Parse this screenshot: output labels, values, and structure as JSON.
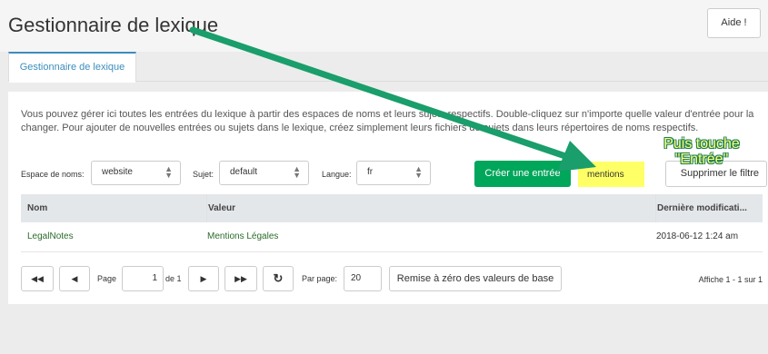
{
  "header": {
    "title": "Gestionnaire de lexique",
    "help_label": "Aide !"
  },
  "tabs": [
    {
      "label": "Gestionnaire de lexique"
    }
  ],
  "description": "Vous pouvez gérer ici toutes les entrées du lexique à partir des espaces de noms et leurs sujets respectifs. Double-cliquez sur n'importe quelle valeur d'entrée pour la changer. Pour ajouter de nouvelles entrées ou sujets dans le lexique, créez simplement leurs fichiers de sujets dans leurs répertoires de noms respectifs.",
  "filters": {
    "namespace_label": "Espace de noms:",
    "namespace_value": "website",
    "topic_label": "Sujet:",
    "topic_value": "default",
    "language_label": "Langue:",
    "language_value": "fr",
    "create_label": "Créer une entrée",
    "search_value": "mentions",
    "clear_filter_label": "Supprimer le filtre"
  },
  "grid": {
    "columns": [
      "Nom",
      "Valeur",
      "Dernière modificati..."
    ],
    "rows": [
      {
        "name": "LegalNotes",
        "value": "Mentions Légales",
        "date": "2018-06-12 1:24 am"
      }
    ]
  },
  "pager": {
    "first_icon": "first-page-icon",
    "prev_icon": "prev-page-icon",
    "next_icon": "next-page-icon",
    "last_icon": "last-page-icon",
    "refresh_icon": "refresh-icon",
    "page_label": "Page",
    "page_value": "1",
    "of_label": "de 1",
    "per_page_label": "Par page:",
    "per_page_value": "20",
    "reset_label": "Remise à zéro des valeurs de base",
    "info": "Affiche 1 - 1 sur 1"
  },
  "annotation": {
    "line1": "Puis touche",
    "line2": "\"Entrée\"",
    "color": "#1a9e6b"
  }
}
